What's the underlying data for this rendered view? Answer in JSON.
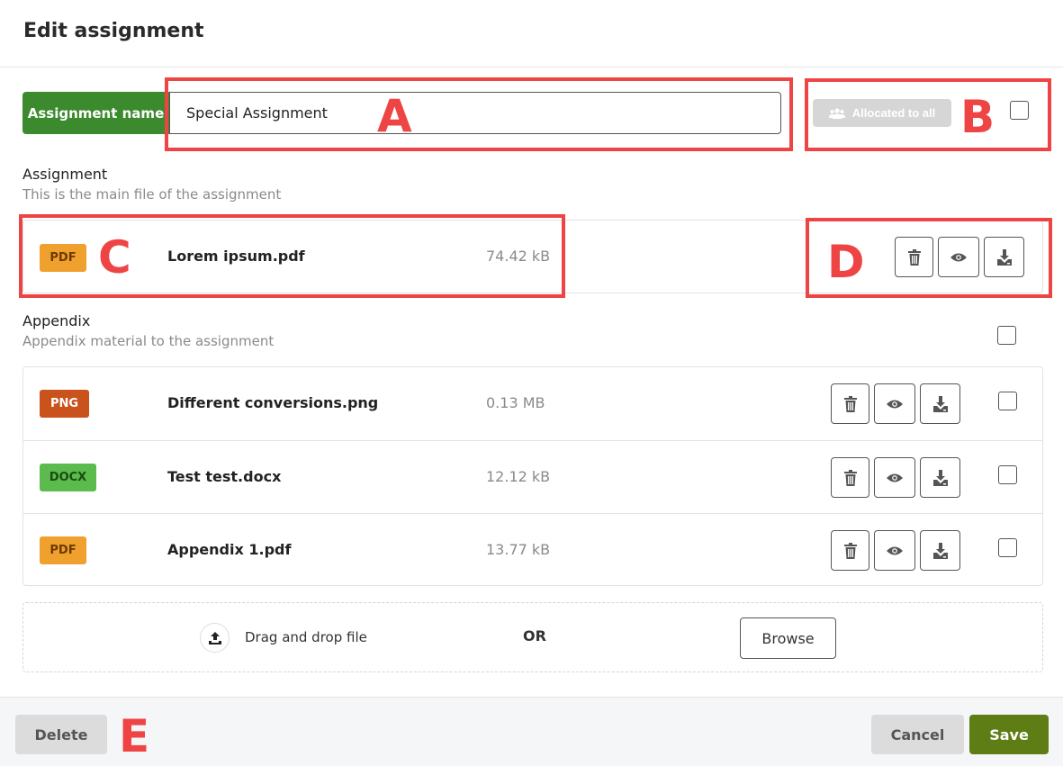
{
  "header": {
    "title": "Edit assignment"
  },
  "name_row": {
    "label": "Assignment name",
    "value": "Special Assignment",
    "allocated_label": "Allocated to all"
  },
  "assignment": {
    "title": "Assignment",
    "subtitle": "This is the main file of the assignment",
    "file": {
      "type": "PDF",
      "name": "Lorem ipsum.pdf",
      "size": "74.42 kB"
    }
  },
  "appendix": {
    "title": "Appendix",
    "subtitle": "Appendix material to the assignment",
    "files": [
      {
        "type": "PNG",
        "name": "Different conversions.png",
        "size": "0.13 MB"
      },
      {
        "type": "DOCX",
        "name": "Test test.docx",
        "size": "12.12 kB"
      },
      {
        "type": "PDF",
        "name": "Appendix 1.pdf",
        "size": "13.77 kB"
      }
    ]
  },
  "upload": {
    "drag_text": "Drag and drop file",
    "or_text": "OR",
    "browse_label": "Browse"
  },
  "footer": {
    "delete_label": "Delete",
    "cancel_label": "Cancel",
    "save_label": "Save"
  },
  "annotations": {
    "a": "A",
    "b": "B",
    "c": "C",
    "d": "D",
    "e": "E"
  },
  "icons": {
    "delete": "trash-icon",
    "preview": "eye-icon",
    "download": "download-icon",
    "upload": "upload-icon",
    "group": "group-icon"
  },
  "colors": {
    "primary_green": "#3c8a2e",
    "save_green": "#5e7d14",
    "annotation_red": "#ee4444",
    "pdf_badge": "#f0a02c",
    "png_badge": "#c9521d",
    "docx_badge": "#5bbb4c"
  }
}
